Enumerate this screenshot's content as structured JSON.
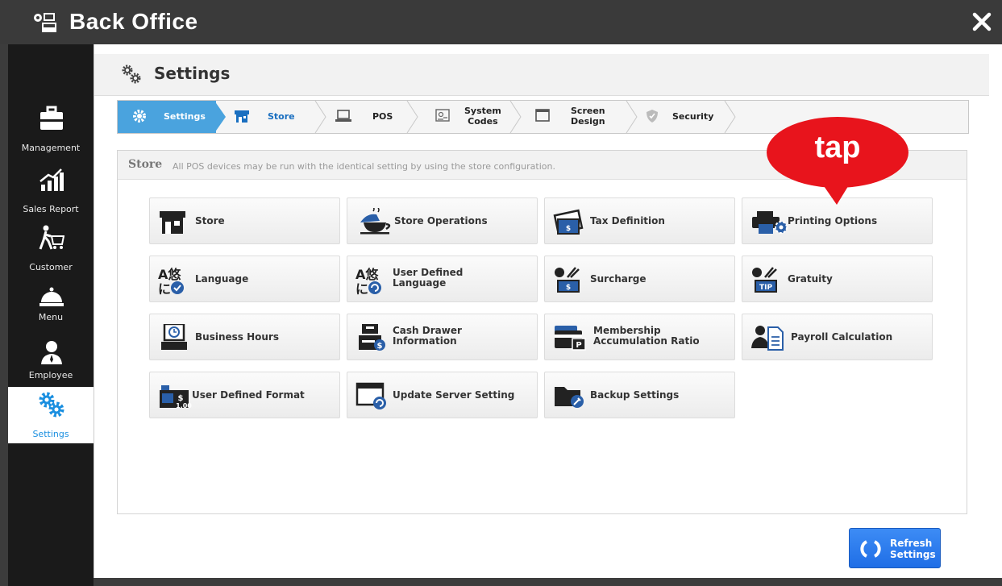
{
  "window": {
    "title": "Back Office",
    "app_icon": "pos-terminal-icon",
    "close_icon": "close-icon"
  },
  "sidebar": {
    "items": [
      {
        "label": "Management",
        "icon": "briefcase-icon",
        "active": false
      },
      {
        "label": "Sales Report",
        "icon": "chart-icon",
        "active": false
      },
      {
        "label": "Customer",
        "icon": "shopping-customer-icon",
        "active": false
      },
      {
        "label": "Menu",
        "icon": "cloche-icon",
        "active": false
      },
      {
        "label": "Employee",
        "icon": "employee-icon",
        "active": false
      },
      {
        "label": "Settings",
        "icon": "gears-icon",
        "active": true
      }
    ]
  },
  "page": {
    "title": "Settings",
    "icon": "gears-icon"
  },
  "breadcrumb": {
    "items": [
      {
        "label": "Settings",
        "icon": "gear-icon",
        "active": true
      },
      {
        "label": "Store",
        "icon": "store-icon",
        "active": false
      },
      {
        "label": "POS",
        "icon": "laptop-icon",
        "active": false
      },
      {
        "label_line1": "System",
        "label_line2": "Codes",
        "icon": "code-list-icon",
        "active": false
      },
      {
        "label_line1": "Screen",
        "label_line2": "Design",
        "icon": "window-icon",
        "active": false
      },
      {
        "label": "Security",
        "icon": "shield-icon",
        "active": false
      }
    ]
  },
  "store_panel": {
    "title": "Store",
    "description": "All POS devices may be run with the identical setting by using the store configuration.",
    "tiles": [
      {
        "label": "Store",
        "icon": "store-icon"
      },
      {
        "label": "Store Operations",
        "icon": "coffee-cup-icon"
      },
      {
        "label": "Tax Definition",
        "icon": "tax-money-icon"
      },
      {
        "label": "Printing Options",
        "icon": "printer-gear-icon"
      },
      {
        "label": "Language",
        "icon": "language-check-icon"
      },
      {
        "label_line1": "User Defined",
        "label_line2": "Language",
        "icon": "language-refresh-icon"
      },
      {
        "label": "Surcharge",
        "icon": "surcharge-money-icon"
      },
      {
        "label": "Gratuity",
        "icon": "tip-icon"
      },
      {
        "label": "Business Hours",
        "icon": "clock-terminal-icon"
      },
      {
        "label_line1": "Cash Drawer",
        "label_line2": "Information",
        "icon": "cash-drawer-icon"
      },
      {
        "label_line1": "Membership",
        "label_line2": "Accumulation Ratio",
        "icon": "membership-card-icon"
      },
      {
        "label": "Payroll Calculation",
        "icon": "payroll-icon"
      },
      {
        "label": "User Defined Format",
        "icon": "format-money-icon"
      },
      {
        "label": "Update Server Setting",
        "icon": "update-window-icon"
      },
      {
        "label": "Backup Settings",
        "icon": "backup-folder-icon"
      }
    ]
  },
  "refresh_button": {
    "label_line1": "Refresh",
    "label_line2": "Settings",
    "icon": "refresh-icon"
  },
  "callout": {
    "text": "tap",
    "color": "#e8141c"
  },
  "colors": {
    "accent": "#1a8fe0",
    "breadcrumb_active": "#4aa3de",
    "button": "#2a7bef"
  }
}
